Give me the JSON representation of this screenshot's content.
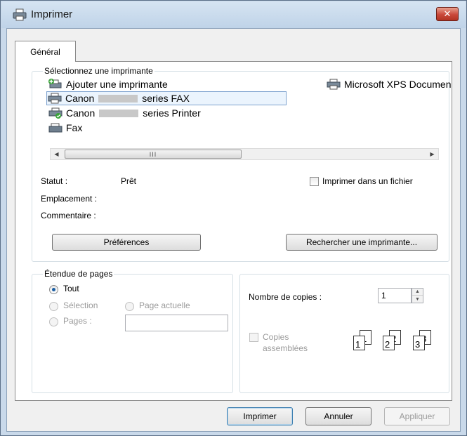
{
  "window": {
    "title": "Imprimer"
  },
  "tabs": [
    {
      "label": "Général"
    }
  ],
  "select_printer": {
    "legend": "Sélectionnez une imprimante",
    "printers": [
      {
        "label": "Ajouter une imprimante",
        "icon": "add-printer-icon"
      },
      {
        "label": "Microsoft XPS Documen",
        "icon": "printer-icon"
      },
      {
        "label_prefix": "Canon",
        "label_suffix": "series FAX",
        "icon": "fax-printer-icon",
        "selected": true
      },
      {
        "label_prefix": "Canon",
        "label_suffix": "series Printer",
        "icon": "default-printer-icon"
      },
      {
        "label": "Fax",
        "icon": "fax-icon"
      }
    ],
    "scroll_thumb_glyph": "III",
    "status_label": "Statut :",
    "status_value": "Prêt",
    "location_label": "Emplacement :",
    "comment_label": "Commentaire :",
    "print_to_file_label": "Imprimer dans un fichier",
    "preferences_button": "Préférences",
    "find_printer_button": "Rechercher une imprimante..."
  },
  "page_range": {
    "legend": "Étendue de pages",
    "options": {
      "all": "Tout",
      "selection": "Sélection",
      "current_page": "Page actuelle",
      "pages": "Pages :"
    },
    "selected": "all",
    "pages_value": ""
  },
  "copies": {
    "label": "Nombre de copies :",
    "value": "1",
    "collate_label_line1": "Copies",
    "collate_label_line2": "assemblées",
    "collate_numbers": [
      "1",
      "1",
      "2",
      "2",
      "3",
      "3"
    ]
  },
  "footer": {
    "print_button": "Imprimer",
    "cancel_button": "Annuler",
    "apply_button": "Appliquer"
  },
  "colors": {
    "selection_bg": "#ebf4fd",
    "selection_border": "#7da2ce",
    "title_bar": "#c9d9ea",
    "close_button": "#c9483a"
  }
}
